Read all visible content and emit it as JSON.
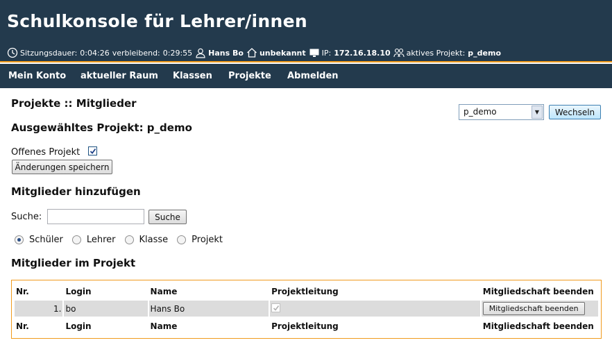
{
  "app": {
    "title": "Schulkonsole für Lehrer/innen"
  },
  "session": {
    "duration_label": "Sitzungsdauer:",
    "duration": "0:04:26",
    "remaining_label": "verbleibend:",
    "remaining": "0:29:55",
    "user": "Hans Bo",
    "room": "unbekannt",
    "ip_label": "IP:",
    "ip": "172.16.18.10",
    "project_label": "aktives Projekt:",
    "project": "p_demo"
  },
  "nav": {
    "items": [
      "Mein Konto",
      "aktueller Raum",
      "Klassen",
      "Projekte",
      "Abmelden"
    ]
  },
  "page": {
    "title": "Projekte :: Mitglieder",
    "selected_project_title": "Ausgewähltes Projekt: p_demo",
    "project_select": {
      "value": "p_demo"
    },
    "switch_button": "Wechseln",
    "open_project_label": "Offenes Projekt",
    "open_project_checked": true,
    "save_button": "Änderungen speichern"
  },
  "add_members": {
    "title": "Mitglieder hinzufügen",
    "search_label": "Suche:",
    "search_value": "",
    "search_button": "Suche",
    "options": [
      "Schüler",
      "Lehrer",
      "Klasse",
      "Projekt"
    ],
    "selected_option": "Schüler"
  },
  "members": {
    "title": "Mitglieder im Projekt",
    "columns": [
      "Nr.",
      "Login",
      "Name",
      "Projektleitung",
      "Mitgliedschaft beenden"
    ],
    "rows": [
      {
        "nr": "1.",
        "login": "bo",
        "name": "Hans Bo",
        "leader": true,
        "action": "Mitgliedschaft beenden"
      }
    ]
  },
  "colors": {
    "header_bg": "#233a4d",
    "accent": "#f09a1c"
  },
  "icons": {
    "duration": "clock-icon",
    "user": "user-icon",
    "room": "house-icon",
    "ip": "monitor-icon",
    "project": "group-icon"
  }
}
